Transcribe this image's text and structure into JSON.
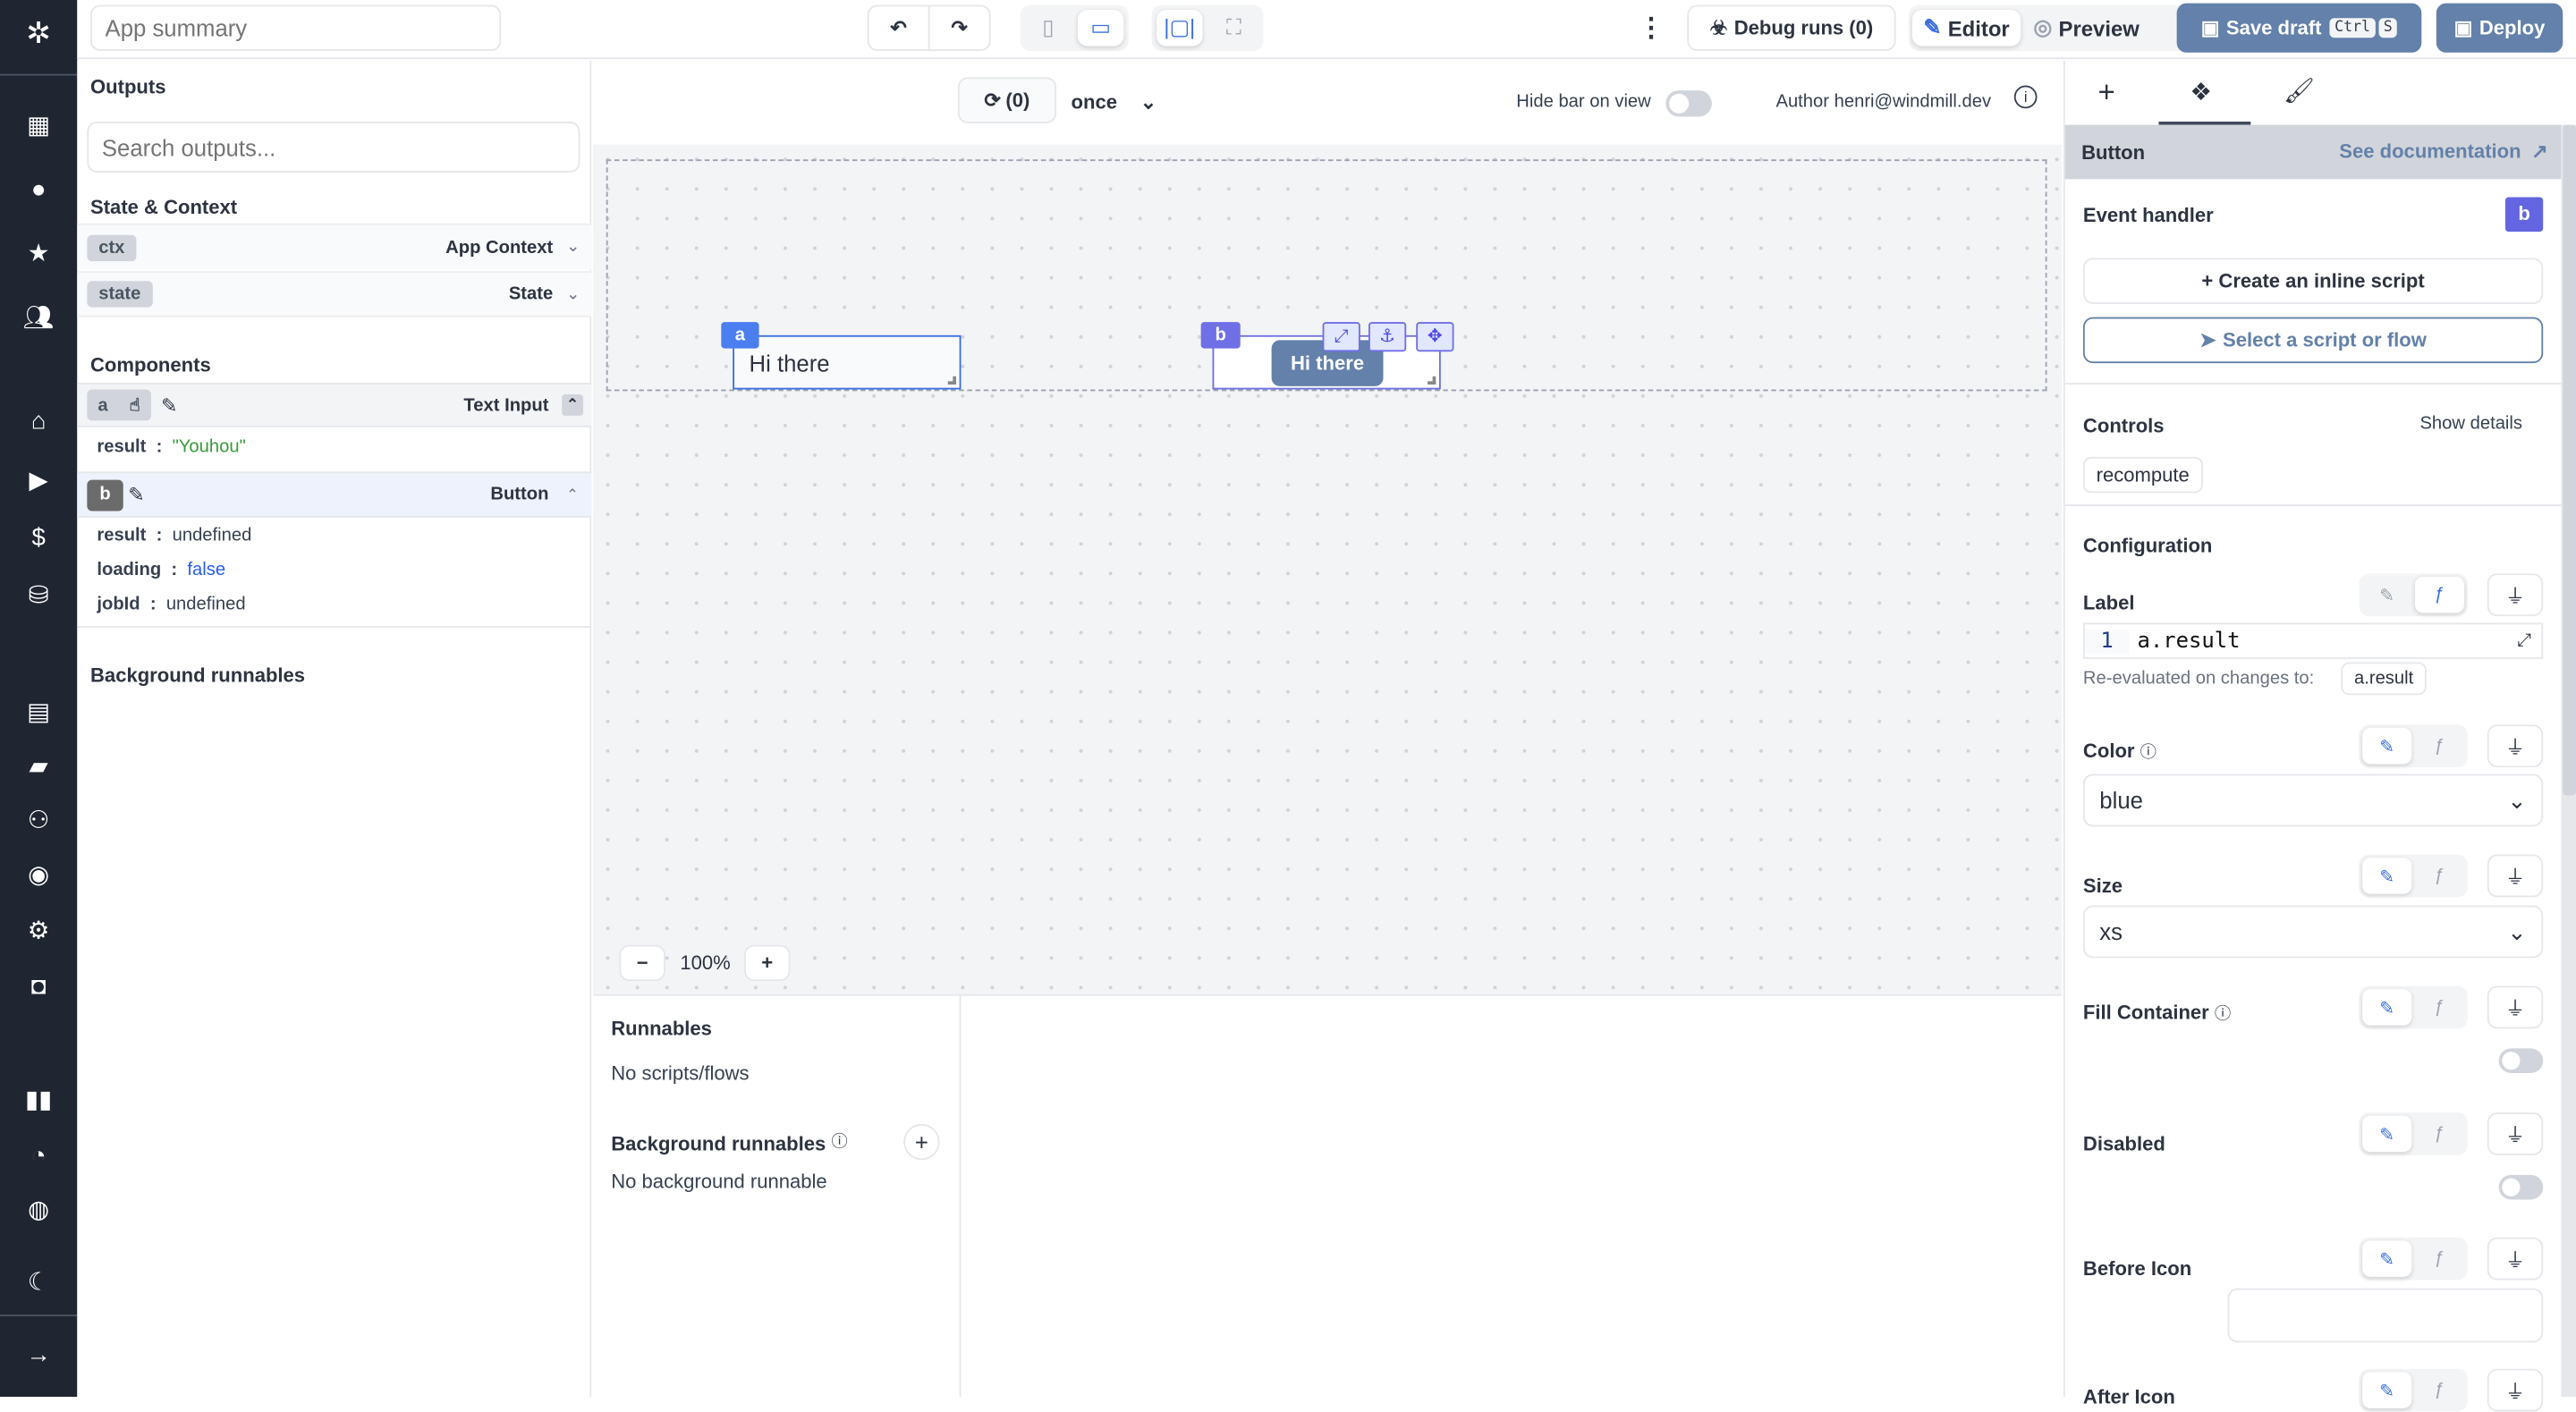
{
  "colors": {
    "sidebar_bg": "#1f2531",
    "accent": "#3b6fe0",
    "primary_button": "#6381aa",
    "component_b": "#6f6fe6",
    "string_value": "#3a9a3a",
    "bool_value": "#2b5cf0"
  },
  "sidebar": {
    "items": [
      {
        "icon": "windmill-logo-icon"
      },
      {
        "icon": "building-icon"
      },
      {
        "icon": "user-icon"
      },
      {
        "icon": "star-icon"
      },
      {
        "icon": "users-icon"
      },
      {
        "icon": "home-icon"
      },
      {
        "icon": "play-icon"
      },
      {
        "icon": "dollar-icon"
      },
      {
        "icon": "boxes-icon"
      },
      {
        "icon": "calendar-icon"
      },
      {
        "icon": "folder-open-icon"
      },
      {
        "icon": "users-group-icon"
      },
      {
        "icon": "eye-icon"
      },
      {
        "icon": "gear-icon"
      },
      {
        "icon": "bot-icon"
      },
      {
        "icon": "book-icon"
      },
      {
        "icon": "discord-icon"
      },
      {
        "icon": "github-icon"
      },
      {
        "icon": "moon-icon"
      },
      {
        "icon": "arrow-right-icon"
      }
    ]
  },
  "topbar": {
    "summary_placeholder": "App summary",
    "debug_runs": "Debug runs (0)",
    "editor": "Editor",
    "preview": "Preview",
    "save_draft": "Save draft",
    "shortcut_ctrl": "Ctrl",
    "shortcut_s": "S",
    "deploy": "Deploy"
  },
  "left": {
    "outputs_title": "Outputs",
    "search_placeholder": "Search outputs...",
    "state_title": "State & Context",
    "ctx_tag": "ctx",
    "ctx_label": "App Context",
    "state_tag": "state",
    "state_label": "State",
    "components_title": "Components",
    "components": [
      {
        "id": "a",
        "type": "Text Input",
        "fields": [
          {
            "key": "result",
            "value": "\"Youhou\""
          }
        ]
      },
      {
        "id": "b",
        "type": "Button",
        "fields": [
          {
            "key": "result",
            "value": "undefined"
          },
          {
            "key": "loading",
            "value": "false"
          },
          {
            "key": "jobId",
            "value": "undefined"
          }
        ]
      }
    ],
    "background_title": "Background runnables"
  },
  "center": {
    "refresh_count": "(0)",
    "run_mode": "once",
    "hide_bar_label": "Hide bar on view",
    "hide_bar_on": false,
    "author": "Author henri@windmill.dev",
    "canvas": {
      "text_input": {
        "id": "a",
        "value": "Hi there"
      },
      "button": {
        "id": "b",
        "label": "Hi there"
      }
    },
    "zoom": "100%",
    "runnables_title": "Runnables",
    "runnables_empty": "No scripts/flows",
    "bg_runnables_title": "Background runnables",
    "bg_runnables_empty": "No background runnable"
  },
  "right": {
    "tabs": [
      {
        "icon": "plus-icon"
      },
      {
        "icon": "component-icon",
        "active": true
      },
      {
        "icon": "paintbrush-icon"
      }
    ],
    "component_name": "Button",
    "docs_link": "See documentation",
    "event_handler": "Event handler",
    "event_badge": "b",
    "create_inline": "+ Create an inline script",
    "select_script": "Select a script or flow",
    "controls": "Controls",
    "show_details": "Show details",
    "control_chip": "recompute",
    "configuration": "Configuration",
    "label": {
      "title": "Label",
      "line_no": "1",
      "code": "a.result",
      "reevaluated": "Re-evaluated on changes to:",
      "dep": "a.result"
    },
    "color": {
      "title": "Color",
      "value": "blue"
    },
    "size": {
      "title": "Size",
      "value": "xs"
    },
    "fill_container": {
      "title": "Fill Container",
      "on": false
    },
    "disabled": {
      "title": "Disabled",
      "on": false
    },
    "before_icon": {
      "title": "Before Icon",
      "value": ""
    },
    "after_icon": {
      "title": "After Icon"
    }
  }
}
